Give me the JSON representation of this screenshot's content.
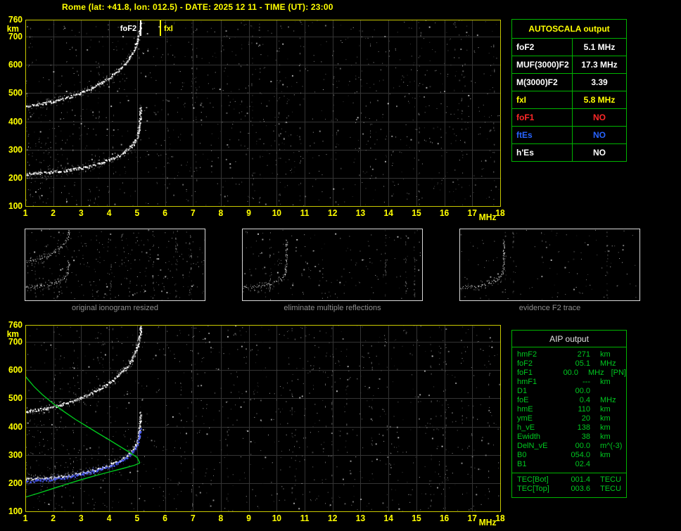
{
  "title": "Rome (lat: +41.8, lon: 012.5) - DATE: 2025 12 11 - TIME (UT): 23:00",
  "colors": {
    "background": "#000000",
    "accent_yellow": "#ffff00",
    "table_border_green": "#00b400",
    "aip_text_green": "#00c820",
    "value_white": "#ffffff",
    "no_red": "#ff2828",
    "es_blue": "#2864ff",
    "caption_gray": "#8f8f8f",
    "plot_border_yellow": "#c8c800",
    "trace_white": "#ffffff",
    "profile_green": "#00c81e",
    "restored_blue": "#4a5cff"
  },
  "autoscala_table": {
    "title": "AUTOSCALA output",
    "rows": [
      {
        "label": "foF2",
        "value": "5.1 MHz",
        "color": "#ffffff"
      },
      {
        "label": "MUF(3000)F2",
        "value": "17.3 MHz",
        "color": "#ffffff"
      },
      {
        "label": "M(3000)F2",
        "value": "3.39",
        "color": "#ffffff"
      },
      {
        "label": "fxI",
        "value": "5.8 MHz",
        "color": "#ffff00"
      },
      {
        "label": "foF1",
        "value": "NO",
        "color": "#ff2828"
      },
      {
        "label": "ftEs",
        "value": "NO",
        "color": "#2864ff"
      },
      {
        "label": "h'Es",
        "value": "NO",
        "color": "#ffffff"
      }
    ]
  },
  "thumbnails": [
    {
      "caption": "original ionogram resized"
    },
    {
      "caption": "eliminate multiple reflections"
    },
    {
      "caption": "evidence F2 trace"
    }
  ],
  "aip_table": {
    "title": "AIP output",
    "rows": [
      {
        "label": "hmF2",
        "value": "271",
        "unit": "km",
        "extra": ""
      },
      {
        "label": "foF2",
        "value": "05.1",
        "unit": "MHz",
        "extra": ""
      },
      {
        "label": "foF1",
        "value": "00.0",
        "unit": "MHz",
        "extra": "[PN]"
      },
      {
        "label": "hmF1",
        "value": "---",
        "unit": "km",
        "extra": ""
      },
      {
        "label": "D1",
        "value": "00.0",
        "unit": "",
        "extra": ""
      },
      {
        "label": "foE",
        "value": "0.4",
        "unit": "MHz",
        "extra": ""
      },
      {
        "label": "hmE",
        "value": "110",
        "unit": "km",
        "extra": ""
      },
      {
        "label": "ymE",
        "value": "20",
        "unit": "km",
        "extra": ""
      },
      {
        "label": "h_vE",
        "value": "138",
        "unit": "km",
        "extra": ""
      },
      {
        "label": "Ewidth",
        "value": "38",
        "unit": "km",
        "extra": ""
      },
      {
        "label": "DelN_vE",
        "value": "00.0",
        "unit": "m^(-3)",
        "extra": ""
      },
      {
        "label": "B0",
        "value": "054.0",
        "unit": "km",
        "extra": ""
      },
      {
        "label": "B1",
        "value": "02.4",
        "unit": "",
        "extra": ""
      }
    ],
    "tec_rows": [
      {
        "label": "TEC[Bot]",
        "value": "001.4",
        "unit": "TECU"
      },
      {
        "label": "TEC[Top]",
        "value": "003.6",
        "unit": "TECU"
      }
    ]
  },
  "chart_data": {
    "trace_library": {
      "f_trace_first_hop": {
        "style": "speckle",
        "color": "#ffffff",
        "points": [
          [
            1.0,
            212
          ],
          [
            1.4,
            215
          ],
          [
            1.8,
            218
          ],
          [
            2.2,
            222
          ],
          [
            2.6,
            227
          ],
          [
            3.0,
            234
          ],
          [
            3.4,
            243
          ],
          [
            3.8,
            255
          ],
          [
            4.1,
            267
          ],
          [
            4.4,
            281
          ],
          [
            4.6,
            294
          ],
          [
            4.8,
            312
          ],
          [
            4.9,
            326
          ],
          [
            5.0,
            346
          ],
          [
            5.05,
            368
          ],
          [
            5.08,
            392
          ],
          [
            5.1,
            422
          ],
          [
            5.11,
            452
          ]
        ]
      },
      "f_trace_first_hop_extended": {
        "style": "speckle",
        "color": "#ffffff",
        "points": [
          [
            1.0,
            212
          ],
          [
            1.4,
            215
          ],
          [
            1.8,
            218
          ],
          [
            2.2,
            222
          ],
          [
            2.6,
            227
          ],
          [
            3.0,
            234
          ],
          [
            3.4,
            243
          ],
          [
            3.8,
            255
          ],
          [
            4.1,
            267
          ],
          [
            4.4,
            281
          ],
          [
            4.6,
            294
          ],
          [
            4.8,
            312
          ],
          [
            4.9,
            326
          ],
          [
            5.0,
            346
          ],
          [
            5.05,
            368
          ],
          [
            5.08,
            392
          ],
          [
            5.1,
            422
          ],
          [
            5.11,
            452
          ],
          [
            5.12,
            505
          ],
          [
            5.13,
            575
          ],
          [
            5.14,
            645
          ]
        ]
      },
      "f_trace_second_hop": {
        "style": "speckle",
        "color": "#ffffff",
        "points": [
          [
            1.0,
            452
          ],
          [
            1.4,
            458
          ],
          [
            1.8,
            465
          ],
          [
            2.2,
            474
          ],
          [
            2.6,
            486
          ],
          [
            3.0,
            501
          ],
          [
            3.4,
            519
          ],
          [
            3.8,
            541
          ],
          [
            4.1,
            561
          ],
          [
            4.4,
            586
          ],
          [
            4.6,
            608
          ],
          [
            4.8,
            636
          ],
          [
            4.9,
            657
          ],
          [
            5.0,
            682
          ],
          [
            5.05,
            702
          ],
          [
            5.1,
            728
          ],
          [
            5.13,
            755
          ]
        ]
      },
      "restored_trace_blue": {
        "style": "speckle",
        "color": "#4a5cff",
        "points": [
          [
            1.0,
            204
          ],
          [
            1.5,
            208
          ],
          [
            2.0,
            213
          ],
          [
            2.5,
            220
          ],
          [
            3.0,
            229
          ],
          [
            3.5,
            241
          ],
          [
            4.0,
            257
          ],
          [
            4.4,
            275
          ],
          [
            4.7,
            295
          ],
          [
            4.9,
            317
          ],
          [
            5.0,
            337
          ],
          [
            5.05,
            359
          ],
          [
            5.1,
            393
          ]
        ]
      },
      "topside_profile": {
        "style": "line",
        "color": "#00c81e",
        "points": [
          [
            1.0,
            578
          ],
          [
            1.3,
            543
          ],
          [
            1.6,
            514
          ],
          [
            2.0,
            481
          ],
          [
            2.4,
            452
          ],
          [
            2.8,
            425
          ],
          [
            3.2,
            401
          ],
          [
            3.6,
            377
          ],
          [
            4.0,
            353
          ],
          [
            4.4,
            329
          ],
          [
            4.7,
            311
          ],
          [
            5.0,
            291
          ],
          [
            5.1,
            271
          ]
        ]
      },
      "bottomside_profile": {
        "style": "line",
        "color": "#00c81e",
        "points": [
          [
            1.0,
            150
          ],
          [
            1.5,
            165
          ],
          [
            2.0,
            181
          ],
          [
            2.5,
            197
          ],
          [
            3.0,
            212
          ],
          [
            3.5,
            226
          ],
          [
            4.0,
            239
          ],
          [
            4.5,
            252
          ],
          [
            4.9,
            263
          ],
          [
            5.1,
            271
          ]
        ]
      }
    },
    "charts": [
      {
        "id": "main_ionogram",
        "type": "scatter",
        "xlabel": "MHz",
        "ylabel": "km",
        "xlim": [
          1,
          18
        ],
        "ylim": [
          100,
          760
        ],
        "xticks": [
          1,
          2,
          3,
          4,
          5,
          6,
          7,
          8,
          9,
          10,
          11,
          12,
          13,
          14,
          15,
          16,
          17,
          18
        ],
        "yticks": [
          100,
          200,
          300,
          400,
          500,
          600,
          700,
          760
        ],
        "grid": true,
        "markers": [
          {
            "label": "foF2",
            "x": 5.1,
            "color": "#ffffff",
            "label_side": "left"
          },
          {
            "label": "fxI",
            "x": 5.8,
            "color": "#ffff00",
            "label_side": "right"
          }
        ],
        "traces": [
          "f_trace_first_hop",
          "f_trace_second_hop"
        ]
      },
      {
        "id": "thumb_original",
        "type": "scatter",
        "xlim": [
          1,
          18
        ],
        "ylim": [
          100,
          760
        ],
        "traces": [
          "f_trace_first_hop",
          "f_trace_second_hop"
        ]
      },
      {
        "id": "thumb_no_multiples",
        "type": "scatter",
        "xlim": [
          1,
          18
        ],
        "ylim": [
          100,
          760
        ],
        "traces": [
          "f_trace_first_hop_extended"
        ]
      },
      {
        "id": "thumb_f2_evidence",
        "type": "scatter",
        "xlim": [
          1,
          18
        ],
        "ylim": [
          100,
          760
        ],
        "traces": [
          "f_trace_first_hop_extended"
        ]
      },
      {
        "id": "profile_ionogram",
        "type": "scatter",
        "xlabel": "MHz",
        "ylabel": "km",
        "xlim": [
          1,
          18
        ],
        "ylim": [
          100,
          760
        ],
        "xticks": [
          1,
          2,
          3,
          4,
          5,
          6,
          7,
          8,
          9,
          10,
          11,
          12,
          13,
          14,
          15,
          16,
          17,
          18
        ],
        "yticks": [
          100,
          200,
          300,
          400,
          500,
          600,
          700,
          760
        ],
        "grid": true,
        "traces": [
          "f_trace_first_hop",
          "f_trace_second_hop",
          "restored_trace_blue",
          "bottomside_profile",
          "topside_profile"
        ]
      }
    ]
  }
}
